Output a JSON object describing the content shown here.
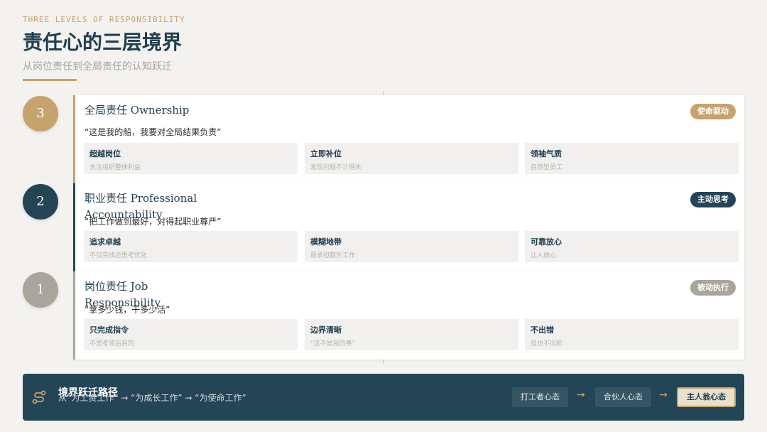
{
  "header": {
    "eyebrow": "THREE LEVELS OF RESPONSIBILITY",
    "title": "责任心的三层境界",
    "subtitle": "从岗位责任到全局责任的认知跃迁"
  },
  "levels": [
    {
      "number": "3",
      "title": "全局责任 Ownership",
      "quote": "“这是我的船，我要对全局结果负责”",
      "badge": "使命驱动",
      "accent": "#c6a26d",
      "items": [
        {
          "title": "超越岗位",
          "desc": "关注组织整体利益"
        },
        {
          "title": "立即补位",
          "desc": "发现问题不计得失"
        },
        {
          "title": "领袖气质",
          "desc": "自燃型员工"
        }
      ]
    },
    {
      "number": "2",
      "title": "职业责任 Professional Accountability",
      "quote": "“把工作做到最好，对得起职业尊严”",
      "badge": "主动思考",
      "accent": "#244556",
      "items": [
        {
          "title": "追求卓越",
          "desc": "不仅完成还思考优化"
        },
        {
          "title": "模糊地带",
          "desc": "愿承担额外工作"
        },
        {
          "title": "可靠放心",
          "desc": "让人放心"
        }
      ]
    },
    {
      "number": "1",
      "title": "岗位责任 Job Responsibility",
      "quote": "“拿多少钱，干多少活”",
      "badge": "被动执行",
      "accent": "#aaa59c",
      "items": [
        {
          "title": "只完成指令",
          "desc": "不思考背后目的"
        },
        {
          "title": "边界清晰",
          "desc": "“这不是我的事”"
        },
        {
          "title": "不出错",
          "desc": "但也不出彩"
        }
      ]
    }
  ],
  "footer": {
    "icon": "path-route-icon",
    "title": "境界跃迁路径",
    "desc": "从“为工资工作” → “为成长工作” → “为使命工作”",
    "steps": [
      "打工者心态",
      "合伙人心态",
      "主人翁心态"
    ],
    "arrow": "→"
  }
}
